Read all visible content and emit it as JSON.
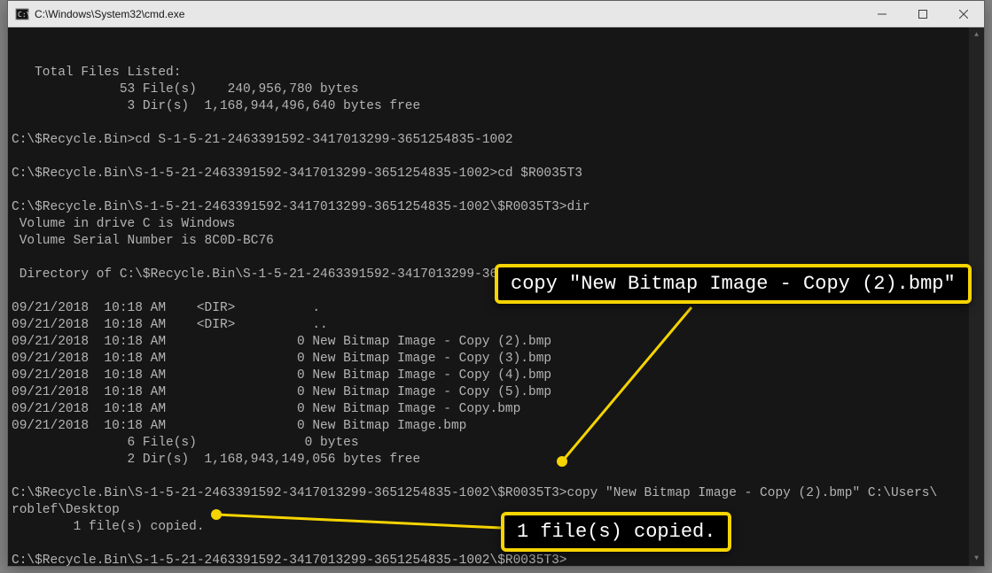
{
  "window": {
    "title": "C:\\Windows\\System32\\cmd.exe"
  },
  "terminal": {
    "lines": [
      "   Total Files Listed:",
      "              53 File(s)    240,956,780 bytes",
      "               3 Dir(s)  1,168,944,496,640 bytes free",
      "",
      "C:\\$Recycle.Bin>cd S-1-5-21-2463391592-3417013299-3651254835-1002",
      "",
      "C:\\$Recycle.Bin\\S-1-5-21-2463391592-3417013299-3651254835-1002>cd $R0035T3",
      "",
      "C:\\$Recycle.Bin\\S-1-5-21-2463391592-3417013299-3651254835-1002\\$R0035T3>dir",
      " Volume in drive C is Windows",
      " Volume Serial Number is 8C0D-BC76",
      "",
      " Directory of C:\\$Recycle.Bin\\S-1-5-21-2463391592-3417013299-3651254835-1002\\$R0035T3",
      "",
      "09/21/2018  10:18 AM    <DIR>          .",
      "09/21/2018  10:18 AM    <DIR>          ..",
      "09/21/2018  10:18 AM                 0 New Bitmap Image - Copy (2).bmp",
      "09/21/2018  10:18 AM                 0 New Bitmap Image - Copy (3).bmp",
      "09/21/2018  10:18 AM                 0 New Bitmap Image - Copy (4).bmp",
      "09/21/2018  10:18 AM                 0 New Bitmap Image - Copy (5).bmp",
      "09/21/2018  10:18 AM                 0 New Bitmap Image - Copy.bmp",
      "09/21/2018  10:18 AM                 0 New Bitmap Image.bmp",
      "               6 File(s)              0 bytes",
      "               2 Dir(s)  1,168,943,149,056 bytes free",
      "",
      "C:\\$Recycle.Bin\\S-1-5-21-2463391592-3417013299-3651254835-1002\\$R0035T3>copy \"New Bitmap Image - Copy (2).bmp\" C:\\Users\\",
      "roblef\\Desktop",
      "        1 file(s) copied.",
      "",
      "C:\\$Recycle.Bin\\S-1-5-21-2463391592-3417013299-3651254835-1002\\$R0035T3>"
    ]
  },
  "callouts": {
    "top": "copy \"New Bitmap Image - Copy (2).bmp\"",
    "bottom": "1 file(s) copied."
  }
}
